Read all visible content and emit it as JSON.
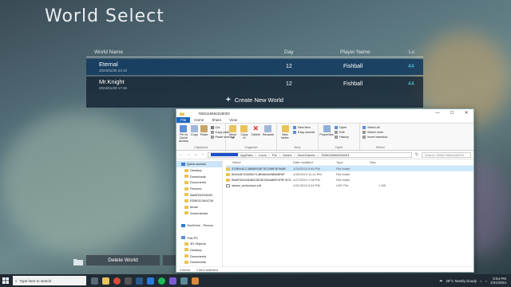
{
  "game": {
    "title": "World Select",
    "columns": {
      "name": "World Name",
      "day": "Day",
      "player": "Player Name",
      "level": "Lv."
    },
    "worlds": [
      {
        "name": "Eternal",
        "date": "2024/01/30 23:10",
        "day": "12",
        "player": "Fishball",
        "level": "44"
      },
      {
        "name": "Mr.Knight",
        "date": "2024/01/29 17:46",
        "day": "12",
        "player": "Fishball",
        "level": "44"
      }
    ],
    "create_label": "Create New World",
    "delete_label": "Delete World"
  },
  "explorer": {
    "title": "7656119884228003",
    "tabs": [
      "File",
      "Home",
      "Share",
      "View"
    ],
    "ribbon": {
      "clipboard": {
        "name": "Clipboard",
        "pin": "Pin to Quick access",
        "copy": "Copy",
        "paste": "Paste",
        "cut": "Cut",
        "copy_path": "Copy path",
        "paste_shortcut": "Paste shortcut"
      },
      "organize": {
        "name": "Organize",
        "move_to": "Move to",
        "copy_to": "Copy to",
        "delete": "Delete",
        "rename": "Rename"
      },
      "new": {
        "name": "New",
        "new_folder": "New folder",
        "new_item": "New item",
        "easy_access": "Easy access"
      },
      "open": {
        "name": "Open",
        "properties": "Properties",
        "open": "Open",
        "edit": "Edit",
        "history": "History"
      },
      "select": {
        "name": "Select",
        "select_all": "Select all",
        "select_none": "Select none",
        "invert": "Invert selection"
      }
    },
    "path": [
      "AppData",
      "Local",
      "Pal",
      "Saved",
      "SaveGames",
      "7656119884228003"
    ],
    "search_placeholder": "Search 7656119884228003",
    "nav": [
      {
        "label": "Quick access",
        "sel": true,
        "sub": false
      },
      {
        "label": "Desktop",
        "sel": false,
        "sub": true
      },
      {
        "label": "Downloads",
        "sel": false,
        "sub": true
      },
      {
        "label": "Documents",
        "sel": false,
        "sub": true
      },
      {
        "label": "Pictures",
        "sel": false,
        "sub": true
      },
      {
        "label": "BA8F05204D81",
        "sel": false,
        "sub": true
      },
      {
        "label": "EDB0113A4C06",
        "sel": false,
        "sub": true
      },
      {
        "label": "Mods",
        "sel": false,
        "sub": true
      },
      {
        "label": "Screenshots",
        "sel": false,
        "sub": true
      },
      {
        "label": "",
        "sel": false,
        "sub": false
      },
      {
        "label": "OneDrive - Person",
        "sel": false,
        "sub": false
      },
      {
        "label": "",
        "sel": false,
        "sub": false
      },
      {
        "label": "This PC",
        "sel": false,
        "sub": false
      },
      {
        "label": "3D Objects",
        "sel": false,
        "sub": true
      },
      {
        "label": "Desktop",
        "sel": false,
        "sub": true
      },
      {
        "label": "Documents",
        "sel": false,
        "sub": true
      },
      {
        "label": "Downloads",
        "sel": false,
        "sub": true
      }
    ],
    "col_headers": {
      "name": "Name",
      "modified": "Date modified",
      "type": "Type",
      "size": "Size"
    },
    "files": [
      {
        "name": "375E84CC45B8F63E7E1290F87465F",
        "modified": "1/29/2024 5:46 PM",
        "type": "File folder",
        "size": "",
        "folder": true,
        "hl": true
      },
      {
        "name": "B444AF2040B4714B0604608588F8F",
        "modified": "1/30/2024 11:10 PM",
        "type": "File folder",
        "size": "",
        "folder": true,
        "hl": false
      },
      {
        "name": "BA8F05204D8515D3E934A8BF3F3F3CD",
        "modified": "1/27/2024 7:08 PM",
        "type": "File folder",
        "size": "",
        "folder": true,
        "hl": false
      },
      {
        "name": "steam_autocloud.vdf",
        "modified": "1/31/2024 5:49 PM",
        "type": "VDF File",
        "size": "1 KB",
        "folder": false,
        "hl": false
      }
    ],
    "status": {
      "items": "4 items",
      "selected": "1 item selected"
    }
  },
  "taskbar": {
    "search_placeholder": "Type here to search",
    "weather": "28°C Mostly cloudy",
    "time": "5:54 PM",
    "date": "1/31/2024"
  }
}
